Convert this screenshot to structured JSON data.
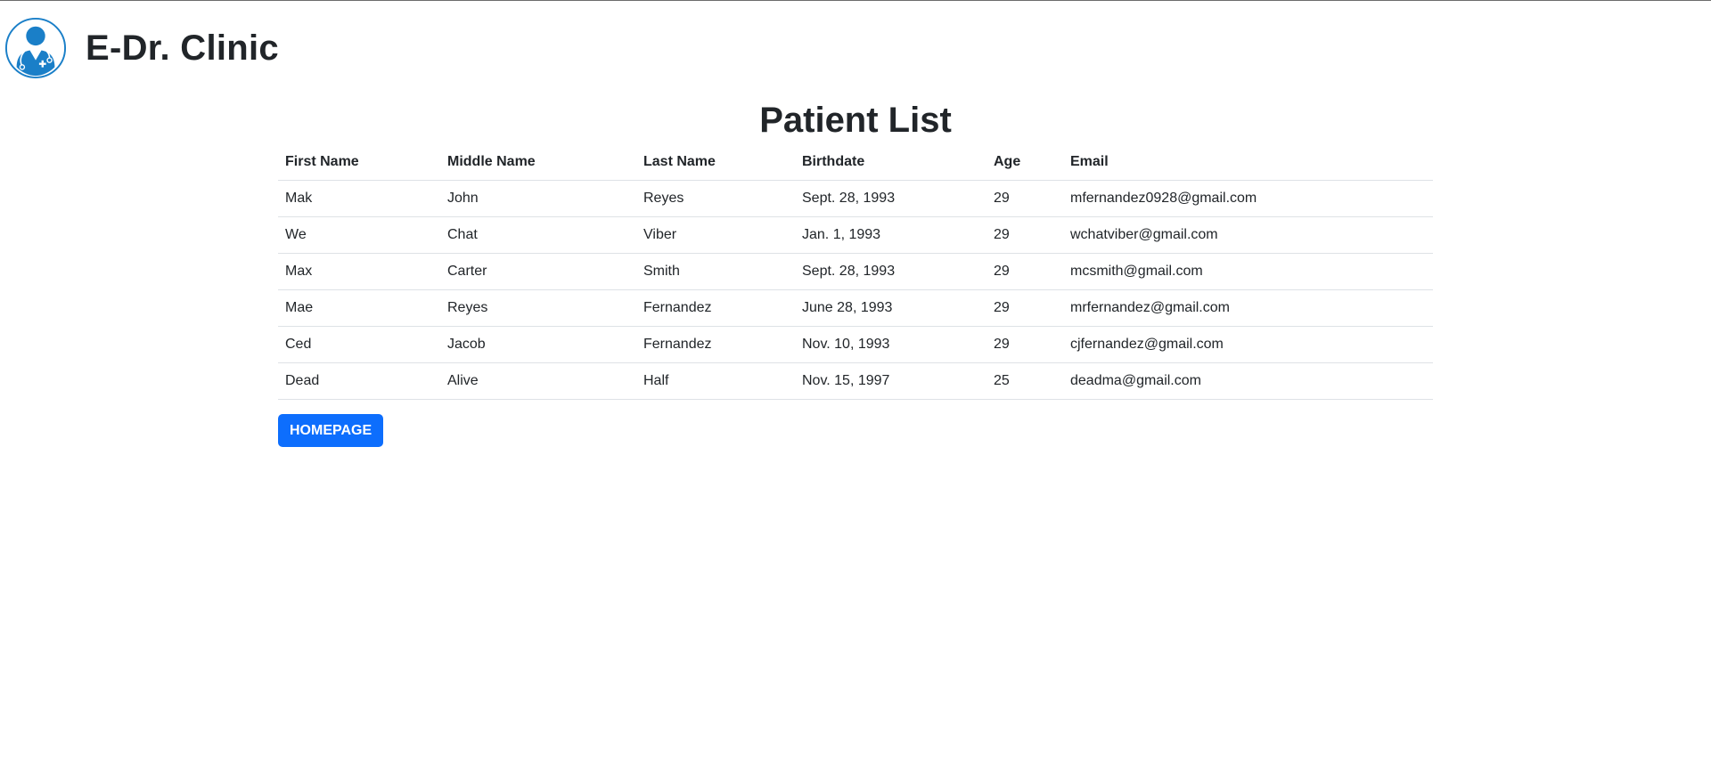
{
  "header": {
    "brand_title": "E-Dr. Clinic",
    "logo_icon": "doctor-avatar-icon",
    "logo_color": "#1a7fc8"
  },
  "main": {
    "title": "Patient List",
    "table": {
      "columns": [
        "First Name",
        "Middle Name",
        "Last Name",
        "Birthdate",
        "Age",
        "Email"
      ],
      "rows": [
        [
          "Mak",
          "John",
          "Reyes",
          "Sept. 28, 1993",
          "29",
          "mfernandez0928@gmail.com"
        ],
        [
          "We",
          "Chat",
          "Viber",
          "Jan. 1, 1993",
          "29",
          "wchatviber@gmail.com"
        ],
        [
          "Max",
          "Carter",
          "Smith",
          "Sept. 28, 1993",
          "29",
          "mcsmith@gmail.com"
        ],
        [
          "Mae",
          "Reyes",
          "Fernandez",
          "June 28, 1993",
          "29",
          "mrfernandez@gmail.com"
        ],
        [
          "Ced",
          "Jacob",
          "Fernandez",
          "Nov. 10, 1993",
          "29",
          "cjfernandez@gmail.com"
        ],
        [
          "Dead",
          "Alive",
          "Half",
          "Nov. 15, 1997",
          "25",
          "deadma@gmail.com"
        ]
      ]
    },
    "homepage_button": "HOMEPAGE",
    "button_color": "#0d6efd"
  }
}
